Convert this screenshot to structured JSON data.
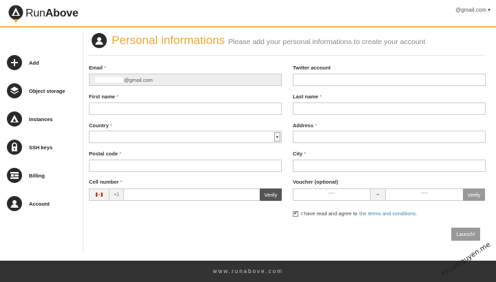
{
  "header": {
    "logo_text_light": "Run",
    "logo_text_bold": "Above",
    "account_email": "@gmail.com",
    "account_caret": "▾"
  },
  "sidebar": {
    "items": [
      {
        "label": "Add",
        "icon": "plus-icon"
      },
      {
        "label": "Object storage",
        "icon": "layers-icon"
      },
      {
        "label": "Instances",
        "icon": "instance-logo-icon"
      },
      {
        "label": "SSH keys",
        "icon": "lock-icon"
      },
      {
        "label": "Billing",
        "icon": "billing-icon"
      },
      {
        "label": "Account",
        "icon": "user-icon"
      }
    ]
  },
  "page": {
    "title": "Personal informations",
    "subtitle": "Please add your personal informations to create your account"
  },
  "form": {
    "required_mark": "*",
    "email": {
      "label": "Email",
      "value": "@gmail.com"
    },
    "twitter": {
      "label": "Twitter account",
      "value": ""
    },
    "first_name": {
      "label": "First name",
      "value": ""
    },
    "last_name": {
      "label": "Last name",
      "value": ""
    },
    "country": {
      "label": "Country",
      "value": ""
    },
    "address": {
      "label": "Address",
      "value": ""
    },
    "postal_code": {
      "label": "Postal code",
      "value": ""
    },
    "city": {
      "label": "City",
      "value": ""
    },
    "cell_number": {
      "label": "Cell number",
      "country_code": "+1",
      "value": "",
      "verify_label": "Verify"
    },
    "voucher": {
      "label": "Voucher (optional)",
      "part1_placeholder": "****",
      "separator": "–",
      "part2_placeholder": "****",
      "verify_label": "Verify"
    },
    "terms": {
      "checked": true,
      "text": "I have read and agree to",
      "link_text": "the terms and conditions."
    },
    "launch_label": "Launch!"
  },
  "footer": {
    "text": "www.runabove.com"
  },
  "watermark": {
    "text": "KhoaNguyen.me"
  },
  "colors": {
    "accent": "#f0a830",
    "dark": "#2a2a2a",
    "footer": "#333333",
    "link": "#3a87ad"
  }
}
